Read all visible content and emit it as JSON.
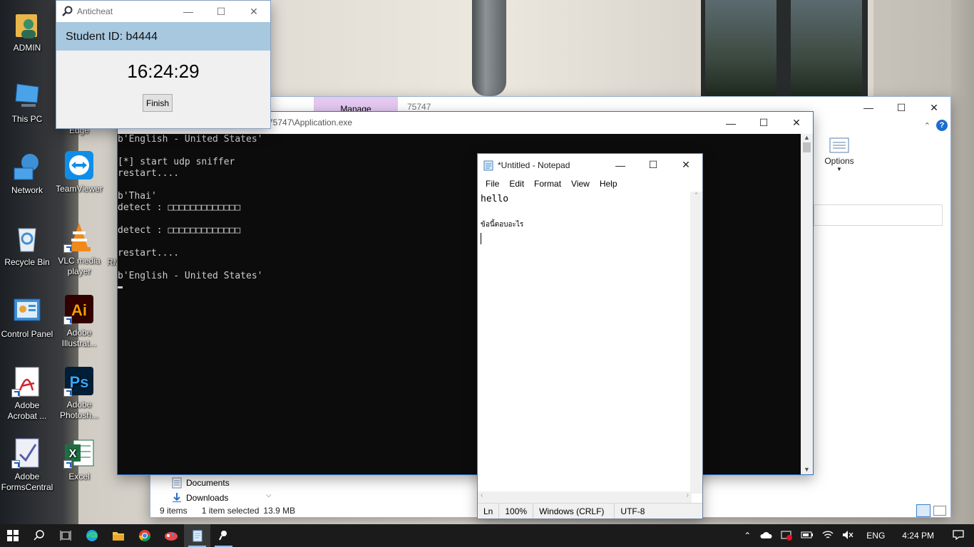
{
  "desktop": {
    "icons": [
      {
        "label": "ADMIN"
      },
      {
        "label": "This PC"
      },
      {
        "label": "Network"
      },
      {
        "label": "Recycle Bin"
      },
      {
        "label": "Control Panel"
      },
      {
        "label": "Adobe Acrobat ..."
      },
      {
        "label": "Adobe FormsCentral"
      },
      {
        "label": "Edge"
      },
      {
        "label": "TeamViewer"
      },
      {
        "label": "VLC media player"
      },
      {
        "label": "Adobe Illustrat..."
      },
      {
        "label": "Adobe Photosh..."
      },
      {
        "label": "Excel"
      },
      {
        "label": "RM"
      }
    ]
  },
  "anticheat": {
    "title": "Anticheat",
    "student_id": "Student ID: b4444",
    "time": "16:24:29",
    "finish_label": "Finish"
  },
  "explorer": {
    "manage_tab": "Manage",
    "path_fragment": "75747",
    "options_label": "Options",
    "nav_items": [
      "Documents",
      "Downloads"
    ],
    "status_items": "9 items",
    "status_selected": "1 item selected",
    "status_size": "13.9 MB"
  },
  "console": {
    "title": "75747\\Application.exe",
    "lines": [
      "b'English - United States'",
      "",
      "[*] start udp sniffer",
      "restart....",
      "",
      "b'Thai'",
      "detect : □□□□□□□□□□□□□",
      "",
      "detect : □□□□□□□□□□□□□",
      "",
      "restart....",
      "",
      "b'English - United States'"
    ]
  },
  "notepad": {
    "title": "*Untitled - Notepad",
    "menu": [
      "File",
      "Edit",
      "Format",
      "View",
      "Help"
    ],
    "text_line1": "hello",
    "text_line2": "ข้อนี้ตอบอะไร",
    "status_ln": "Ln",
    "status_zoom": "100%",
    "status_eol": "Windows (CRLF)",
    "status_enc": "UTF-8"
  },
  "taskbar": {
    "tray_lang": "ENG",
    "tray_time": "4:24 PM"
  }
}
